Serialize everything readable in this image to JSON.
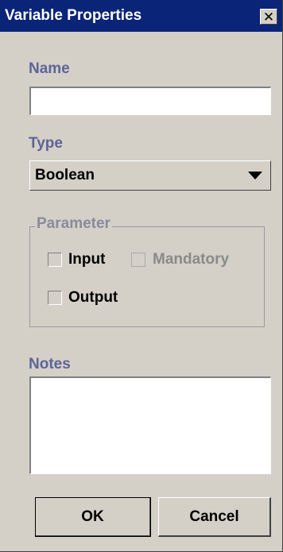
{
  "window": {
    "title": "Variable Properties",
    "close_glyph": "✕"
  },
  "name": {
    "label": "Name",
    "value": ""
  },
  "type": {
    "label": "Type",
    "selected": "Boolean"
  },
  "parameter": {
    "legend": "Parameter",
    "input_label": "Input",
    "input_checked": false,
    "mandatory_label": "Mandatory",
    "mandatory_checked": false,
    "mandatory_enabled": false,
    "output_label": "Output",
    "output_checked": false
  },
  "notes": {
    "label": "Notes",
    "value": ""
  },
  "buttons": {
    "ok_label": "OK",
    "cancel_label": "Cancel"
  },
  "colors": {
    "titlebar": "#0a2478",
    "label_blue": "#5d6497",
    "face": "#d4d0c8"
  }
}
